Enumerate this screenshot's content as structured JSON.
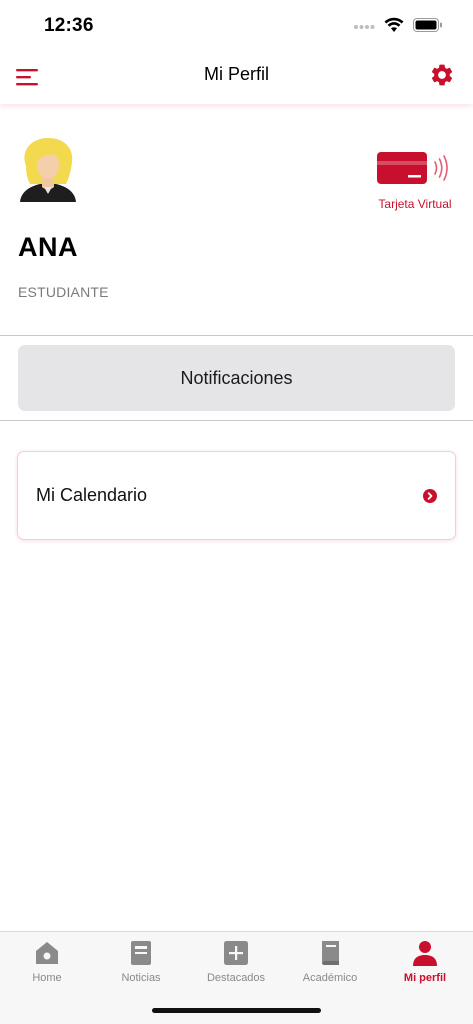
{
  "status_bar": {
    "time": "12:36"
  },
  "header": {
    "title": "Mi Perfil"
  },
  "profile": {
    "name": "ANA",
    "role": "ESTUDIANTE",
    "virtual_card_label": "Tarjeta Virtual"
  },
  "notifications_button": {
    "label": "Notificaciones"
  },
  "calendar": {
    "label": "Mi Calendario"
  },
  "tab_bar": {
    "items": [
      {
        "label": "Home",
        "icon": "home-icon",
        "active": false
      },
      {
        "label": "Noticias",
        "icon": "newspaper-icon",
        "active": false
      },
      {
        "label": "Destacados",
        "icon": "plus-box-icon",
        "active": false
      },
      {
        "label": "Académico",
        "icon": "book-icon",
        "active": false
      },
      {
        "label": "Mi perfil",
        "icon": "person-icon",
        "active": true
      }
    ]
  },
  "colors": {
    "accent": "#c8102e",
    "tab_inactive": "#8a8a8a",
    "button_bg": "#e5e5e7"
  }
}
